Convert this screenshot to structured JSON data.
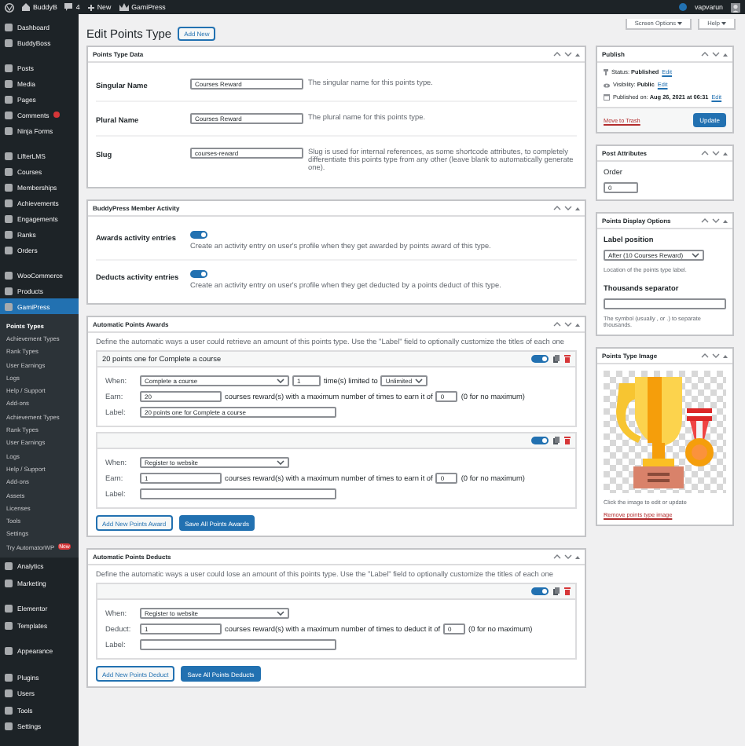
{
  "admin_bar": {
    "site": "BuddyB",
    "comments": "4",
    "new": "New",
    "plugin": "GamiPress",
    "user": "vapvarun"
  },
  "sidebar": {
    "items": [
      {
        "label": "Dashboard",
        "selected": false,
        "group_start": false,
        "badge": false
      },
      {
        "label": "BuddyBoss",
        "selected": false,
        "group_start": false,
        "badge": false
      },
      {
        "label": "Posts",
        "selected": false,
        "group_start": true,
        "badge": false
      },
      {
        "label": "Media",
        "selected": false,
        "group_start": false,
        "badge": false
      },
      {
        "label": "Pages",
        "selected": false,
        "group_start": false,
        "badge": false
      },
      {
        "label": "Comments",
        "selected": false,
        "group_start": false,
        "badge": true
      },
      {
        "label": "Ninja Forms",
        "selected": false,
        "group_start": false,
        "badge": false
      },
      {
        "label": "LifterLMS",
        "selected": false,
        "group_start": true,
        "badge": false
      },
      {
        "label": "Courses",
        "selected": false,
        "group_start": false,
        "badge": false
      },
      {
        "label": "Memberships",
        "selected": false,
        "group_start": false,
        "badge": false
      },
      {
        "label": "Achievements",
        "selected": false,
        "group_start": false,
        "badge": false
      },
      {
        "label": "Engagements",
        "selected": false,
        "group_start": false,
        "badge": false
      },
      {
        "label": "Ranks",
        "selected": false,
        "group_start": false,
        "badge": false
      },
      {
        "label": "Orders",
        "selected": false,
        "group_start": false,
        "badge": false
      },
      {
        "label": "WooCommerce",
        "selected": false,
        "group_start": true,
        "badge": false
      },
      {
        "label": "Products",
        "selected": false,
        "group_start": false,
        "badge": false
      },
      {
        "label": "GamiPress",
        "selected": true,
        "group_start": false,
        "badge": false
      }
    ],
    "submenu": [
      {
        "label": "Points Types",
        "selected": true
      },
      {
        "label": "Achievement Types",
        "selected": false
      },
      {
        "label": "Rank Types",
        "selected": false
      },
      {
        "label": "User Earnings",
        "selected": false
      },
      {
        "label": "Logs",
        "selected": false
      },
      {
        "label": "Help / Support",
        "selected": false
      },
      {
        "label": "Add-ons",
        "selected": false
      },
      {
        "label": "Achievement Types",
        "selected": false
      },
      {
        "label": "Rank Types",
        "selected": false
      },
      {
        "label": "User Earnings",
        "selected": false
      },
      {
        "label": "Logs",
        "selected": false
      },
      {
        "label": "Help / Support",
        "selected": false
      },
      {
        "label": "Add-ons",
        "selected": false
      },
      {
        "label": "Assets",
        "selected": false
      },
      {
        "label": "Licenses",
        "selected": false
      },
      {
        "label": "Tools",
        "selected": false
      },
      {
        "label": "Settings",
        "selected": false
      }
    ],
    "promo": {
      "label": "Try AutomatorWP",
      "badge": "New"
    },
    "lower_items": [
      {
        "label": "Analytics",
        "group_start": false
      },
      {
        "label": "Marketing",
        "group_start": false
      },
      {
        "label": "Elementor",
        "group_start": true
      },
      {
        "label": "Templates",
        "group_start": false
      },
      {
        "label": "Appearance",
        "group_start": true
      },
      {
        "label": "Plugins",
        "group_start": true
      },
      {
        "label": "Users",
        "group_start": false
      },
      {
        "label": "Tools",
        "group_start": false
      },
      {
        "label": "Settings",
        "group_start": false
      }
    ]
  },
  "page": {
    "title": "Edit Points Type",
    "add_new": "Add New",
    "screen_options": "Screen Options",
    "help": "Help"
  },
  "points_type_data": {
    "title": "Points Type Data",
    "fields": [
      {
        "label": "Singular Name",
        "value": "Courses Reward",
        "description": "The singular name for this points type."
      },
      {
        "label": "Plural Name",
        "value": "Courses Reward",
        "description": "The plural name for this points type."
      },
      {
        "label": "Slug",
        "value": "courses-reward",
        "description": "Slug is used for internal references, as some shortcode attributes, to completely differentiate this points type from any other (leave blank to automatically generate one)."
      }
    ]
  },
  "buddypress_activity": {
    "title": "BuddyPress Member Activity",
    "rows": [
      {
        "label": "Awards activity entries",
        "on": true,
        "description": "Create an activity entry on user's profile when they get awarded by points award of this type."
      },
      {
        "label": "Deducts activity entries",
        "on": true,
        "description": "Create an activity entry on user's profile when they get deducted by a points deduct of this type."
      }
    ]
  },
  "points_awards": {
    "title": "Automatic Points Awards",
    "intro": "Define the automatic ways a user could retrieve an amount of this points type. Use the \"Label\" field to optionally customize the titles of each one",
    "items": [
      {
        "title": "20 points one for Complete a course",
        "enabled": true,
        "when_label": "When:",
        "when": "Complete a course",
        "times": "1",
        "times_text": "time(s) limited to",
        "limit": "Unlimited",
        "amount_label": "Earn:",
        "amount": "20",
        "max_text": "courses reward(s) with a maximum number of times to earn it of",
        "max": "0",
        "max_note": "(0 for no maximum)",
        "label_label": "Label:",
        "label": "20 points one for Complete a course"
      },
      {
        "enabled": true,
        "when_label": "When:",
        "when": "Register to website",
        "amount_label": "Earn:",
        "amount": "1",
        "max_text": "courses reward(s) with a maximum number of times to earn it of",
        "max": "0",
        "max_note": "(0 for no maximum)",
        "label_label": "Label:"
      }
    ],
    "buttons": [
      {
        "label": "Add New Points Award",
        "kind": "secondary"
      },
      {
        "label": "Save All Points Awards",
        "kind": "primary"
      }
    ]
  },
  "points_deducts": {
    "title": "Automatic Points Deducts",
    "intro": "Define the automatic ways a user could lose an amount of this points type. Use the \"Label\" field to optionally customize the titles of each one",
    "items": [
      {
        "enabled": true,
        "when_label": "When:",
        "when": "Register to website",
        "amount_label": "Deduct:",
        "amount": "1",
        "max_text": "courses reward(s) with a maximum number of times to deduct it of",
        "max": "0",
        "max_note": "(0 for no maximum)",
        "label_label": "Label:"
      }
    ],
    "buttons": [
      {
        "label": "Add New Points Deduct",
        "kind": "secondary"
      },
      {
        "label": "Save All Points Deducts",
        "kind": "primary"
      }
    ]
  },
  "publish": {
    "title": "Publish",
    "status_label": "Status:",
    "status": "Published",
    "status_edit": "Edit",
    "visibility_label": "Visibility:",
    "visibility": "Public",
    "visibility_edit": "Edit",
    "date_label": "Published on:",
    "date": "Aug 26, 2021 at 06:31",
    "date_edit": "Edit",
    "trash": "Move to Trash",
    "update": "Update"
  },
  "post_attributes": {
    "title": "Post Attributes",
    "order_label": "Order",
    "order": "0"
  },
  "display_options": {
    "title": "Points Display Options",
    "position_label": "Label position",
    "position": "After (10 Courses Reward)",
    "position_note": "Location of the points type label.",
    "separator_label": "Thousands separator",
    "separator_note": "The symbol (usually , or .) to separate thousands."
  },
  "points_image": {
    "title": "Points Type Image",
    "hint": "Click the image to edit or update",
    "remove": "Remove points type image"
  }
}
